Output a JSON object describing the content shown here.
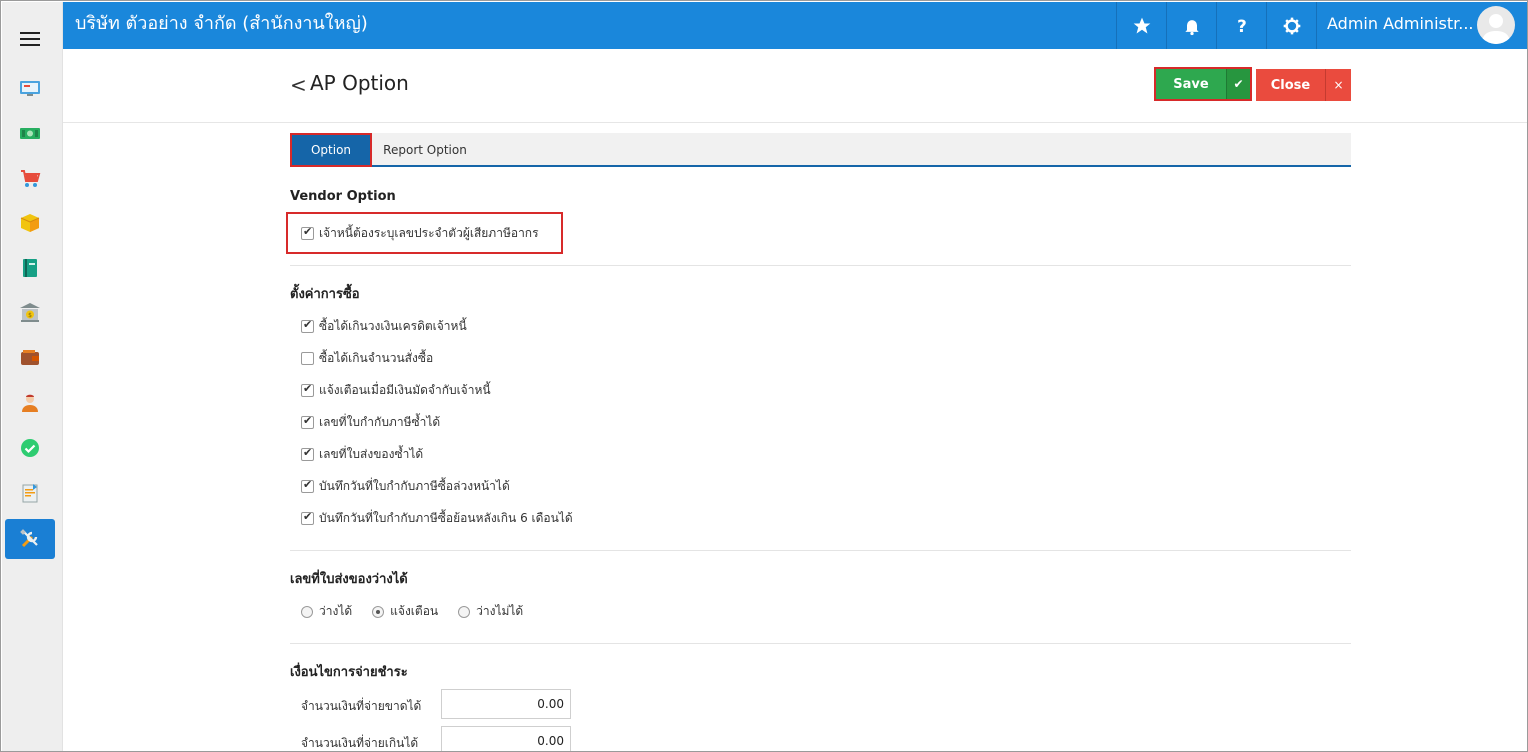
{
  "topbar": {
    "company": "บริษัท ตัวอย่าง จำกัด (สำนักงานใหญ่)",
    "user_name": "Admin Administr...",
    "icons": [
      "star-icon",
      "bell-icon",
      "help-icon",
      "gear-icon"
    ]
  },
  "sidebar": {
    "items": [
      {
        "name": "dashboard",
        "icon": "monitor-icon"
      },
      {
        "name": "sales",
        "icon": "money-icon"
      },
      {
        "name": "purchase",
        "icon": "cart-icon"
      },
      {
        "name": "inventory",
        "icon": "box-icon"
      },
      {
        "name": "accounting",
        "icon": "book-icon"
      },
      {
        "name": "bank",
        "icon": "bank-icon"
      },
      {
        "name": "wallet",
        "icon": "wallet-icon"
      },
      {
        "name": "employee",
        "icon": "person-icon"
      },
      {
        "name": "approval",
        "icon": "check-circle-icon"
      },
      {
        "name": "report",
        "icon": "report-icon"
      },
      {
        "name": "settings",
        "icon": "tools-icon",
        "active": true
      }
    ]
  },
  "header": {
    "back": "<",
    "title": "AP Option",
    "save_label": "Save",
    "save_check": "✔",
    "close_label": "Close",
    "close_x": "×"
  },
  "tabs": {
    "option": "Option",
    "report_option": "Report Option"
  },
  "vendor": {
    "title": "Vendor Option",
    "tax_id_required": {
      "label": "เจ้าหนี้ต้องระบุเลขประจำตัวผู้เสียภาษีอากร",
      "checked": true
    }
  },
  "purchase": {
    "title": "ตั้งค่าการซื้อ",
    "options": [
      {
        "label": "ซื้อได้เกินวงเงินเครดิตเจ้าหนี้",
        "checked": true
      },
      {
        "label": "ซื้อได้เกินจำนวนสั่งซื้อ",
        "checked": false
      },
      {
        "label": "แจ้งเตือนเมื่อมีเงินมัดจำกับเจ้าหนี้",
        "checked": true
      },
      {
        "label": "เลขที่ใบกำกับภาษีซ้ำได้",
        "checked": true
      },
      {
        "label": "เลขที่ใบส่งของซ้ำได้",
        "checked": true
      },
      {
        "label": "บันทึกวันที่ใบกำกับภาษีซื้อล่วงหน้าได้",
        "checked": true
      },
      {
        "label": "บันทึกวันที่ใบกำกับภาษีซื้อย้อนหลังเกิน 6 เดือนได้",
        "checked": true
      }
    ]
  },
  "delivery_blank": {
    "title": "เลขที่ใบส่งของว่างได้",
    "options": [
      {
        "label": "ว่างได้",
        "selected": false
      },
      {
        "label": "แจ้งเตือน",
        "selected": true
      },
      {
        "label": "ว่างไม่ได้",
        "selected": false
      }
    ]
  },
  "payment": {
    "title": "เงื่อนไขการจ่ายชำระ",
    "underpay_label": "จำนวนเงินที่จ่ายขาดได้",
    "underpay_value": "0.00",
    "overpay_label": "จำนวนเงินที่จ่ายเกินได้",
    "overpay_value": "0.00"
  }
}
